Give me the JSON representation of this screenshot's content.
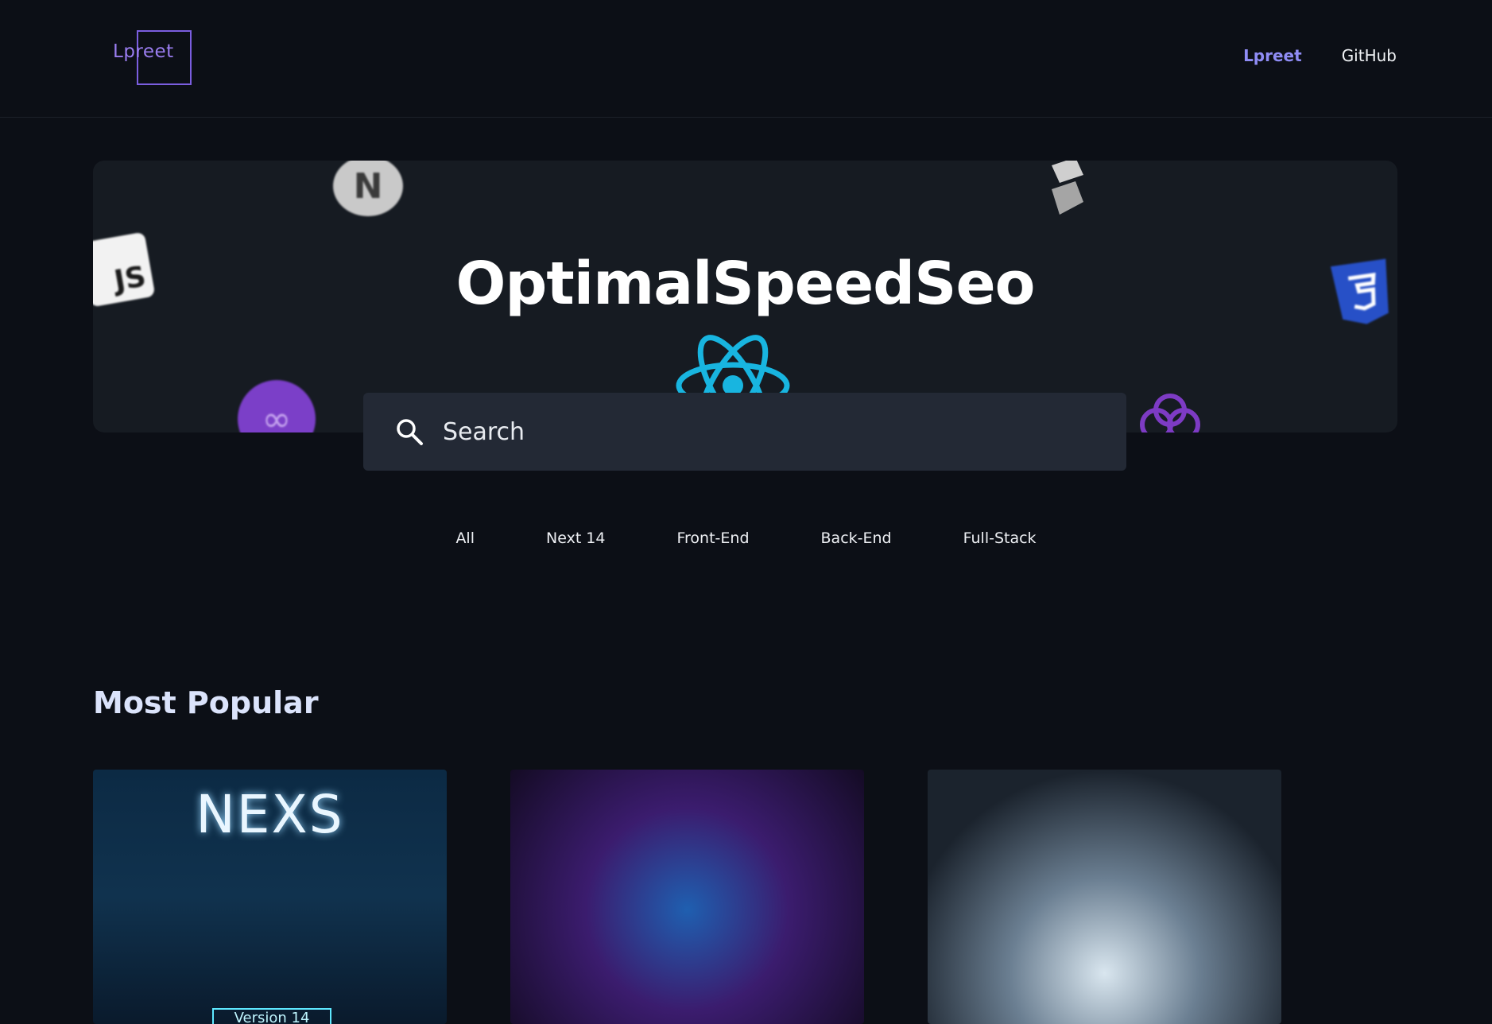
{
  "navbar": {
    "logo_text": "Lpreet",
    "links": [
      {
        "label": "Lpreet"
      },
      {
        "label": "GitHub"
      }
    ]
  },
  "hero": {
    "title": "OptimalSpeedSeo",
    "icons": [
      "nextjs-icon",
      "javascript-icon",
      "stack-icon",
      "css3-icon",
      "react-icon",
      "polygon-icon",
      "graphql-icon"
    ]
  },
  "search": {
    "placeholder": "Search"
  },
  "filters": [
    {
      "label": "All"
    },
    {
      "label": "Next 14"
    },
    {
      "label": "Front-End"
    },
    {
      "label": "Back-End"
    },
    {
      "label": "Full-Stack"
    }
  ],
  "section": {
    "title": "Most Popular"
  },
  "cards": [
    {
      "image_text": "NEXS",
      "sub_text": "Version 14"
    },
    {
      "image_text": ""
    },
    {
      "image_text": ""
    }
  ],
  "colors": {
    "background": "#0c0f16",
    "hero": "#161b22",
    "search": "#232935",
    "accent": "#8f8cf5"
  }
}
